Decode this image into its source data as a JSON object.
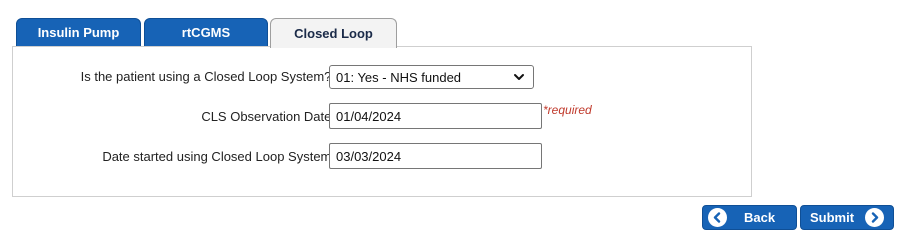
{
  "tabs": [
    {
      "label": "Insulin Pump",
      "active": false
    },
    {
      "label": "rtCGMS",
      "active": false
    },
    {
      "label": "Closed Loop",
      "active": true
    }
  ],
  "form": {
    "cls_question": {
      "label": "Is the patient using a Closed Loop System?:",
      "value": "01: Yes - NHS funded"
    },
    "observation_date": {
      "label": "CLS Observation Date:",
      "value": "01/04/2024",
      "required_note": "*required"
    },
    "date_started": {
      "label": "Date started using Closed Loop System:",
      "value": "03/03/2024"
    }
  },
  "buttons": {
    "back": "Back",
    "submit": "Submit"
  },
  "colors": {
    "primary": "#1763b6",
    "required": "#c0392b"
  },
  "icons": {
    "dropdown": "chevron-down-icon",
    "back": "chevron-left-circle-icon",
    "submit": "chevron-right-circle-icon"
  }
}
